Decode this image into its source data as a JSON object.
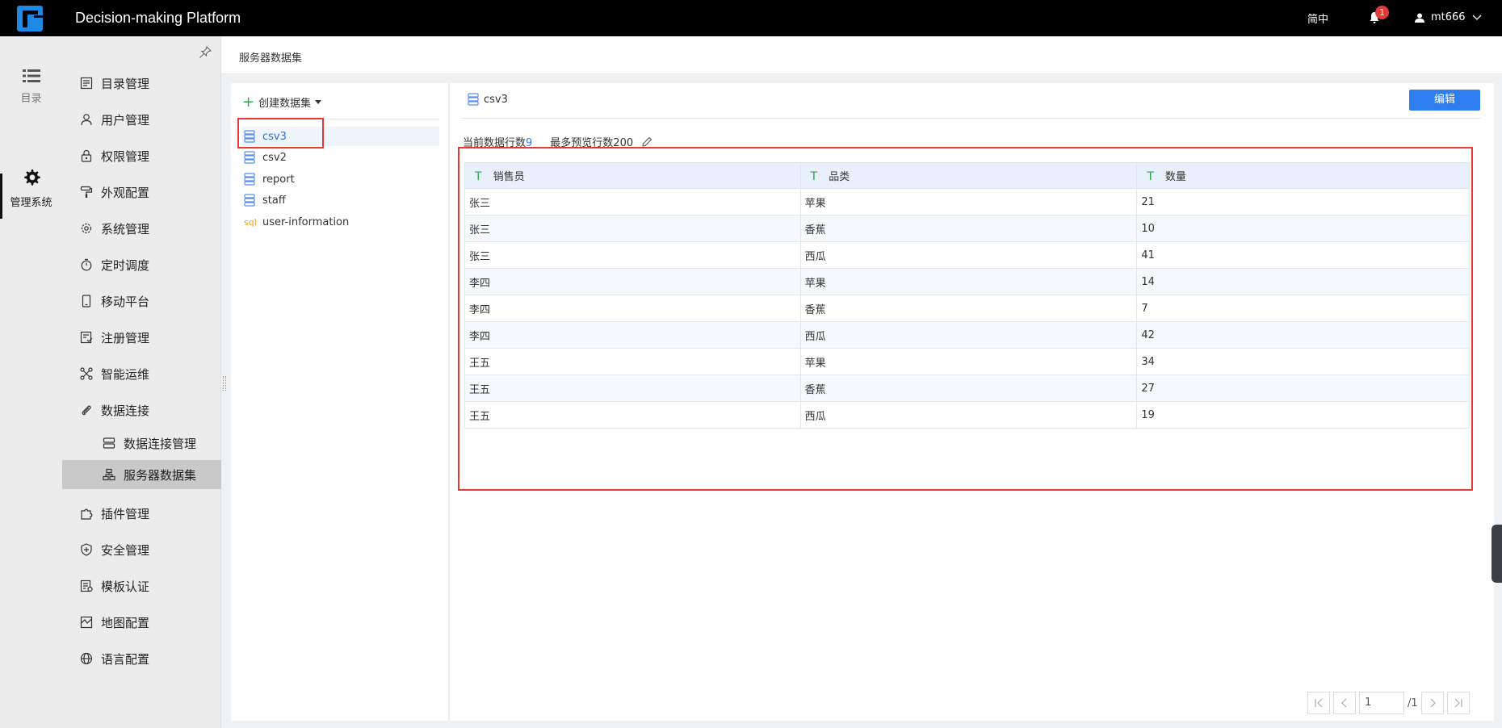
{
  "topbar": {
    "title": "Decision-making Platform",
    "lang": "简中",
    "notification_count": "1",
    "username": "mt666"
  },
  "rail": {
    "catalog_label": "目录",
    "admin_label": "管理系统"
  },
  "menu": {
    "items": [
      {
        "label": "目录管理",
        "icon": "catalog-icon"
      },
      {
        "label": "用户管理",
        "icon": "user-icon"
      },
      {
        "label": "权限管理",
        "icon": "lock-icon"
      },
      {
        "label": "外观配置",
        "icon": "paint-roller-icon"
      },
      {
        "label": "系统管理",
        "icon": "gear-icon"
      },
      {
        "label": "定时调度",
        "icon": "timer-icon"
      },
      {
        "label": "移动平台",
        "icon": "mobile-icon"
      },
      {
        "label": "注册管理",
        "icon": "register-icon"
      },
      {
        "label": "智能运维",
        "icon": "nodes-icon"
      },
      {
        "label": "数据连接",
        "icon": "paperclip-icon"
      }
    ],
    "sub_items": [
      {
        "label": "数据连接管理",
        "icon": "db-server-icon"
      },
      {
        "label": "服务器数据集",
        "icon": "dataset-icon"
      }
    ],
    "items_after": [
      {
        "label": "插件管理",
        "icon": "puzzle-icon"
      },
      {
        "label": "安全管理",
        "icon": "shield-icon"
      },
      {
        "label": "模板认证",
        "icon": "template-icon"
      },
      {
        "label": "地图配置",
        "icon": "map-icon"
      },
      {
        "label": "语言配置",
        "icon": "globe-icon"
      }
    ]
  },
  "breadcrumb": "服务器数据集",
  "datasets": {
    "create_label": "创建数据集",
    "items": [
      {
        "name": "csv3",
        "type": "table"
      },
      {
        "name": "csv2",
        "type": "table"
      },
      {
        "name": "report",
        "type": "table"
      },
      {
        "name": "staff",
        "type": "table"
      },
      {
        "name": "user-information",
        "type": "sql"
      }
    ]
  },
  "preview": {
    "title": "csv3",
    "edit_label": "编辑",
    "rows_label": "当前数据行数",
    "rows_value": "9",
    "max_preview_label": "最多预览行数200",
    "columns": [
      "销售员",
      "品类",
      "数量"
    ],
    "rows": [
      [
        "张三",
        "苹果",
        "21"
      ],
      [
        "张三",
        "香蕉",
        "10"
      ],
      [
        "张三",
        "西瓜",
        "41"
      ],
      [
        "李四",
        "苹果",
        "14"
      ],
      [
        "李四",
        "香蕉",
        "7"
      ],
      [
        "李四",
        "西瓜",
        "42"
      ],
      [
        "王五",
        "苹果",
        "34"
      ],
      [
        "王五",
        "香蕉",
        "27"
      ],
      [
        "王五",
        "西瓜",
        "19"
      ]
    ]
  },
  "pager": {
    "page": "1",
    "total": "/1"
  },
  "colors": {
    "accent": "#2e7ef0",
    "highlight_box": "#e53935",
    "column_type_icon": "#2ea44f"
  }
}
